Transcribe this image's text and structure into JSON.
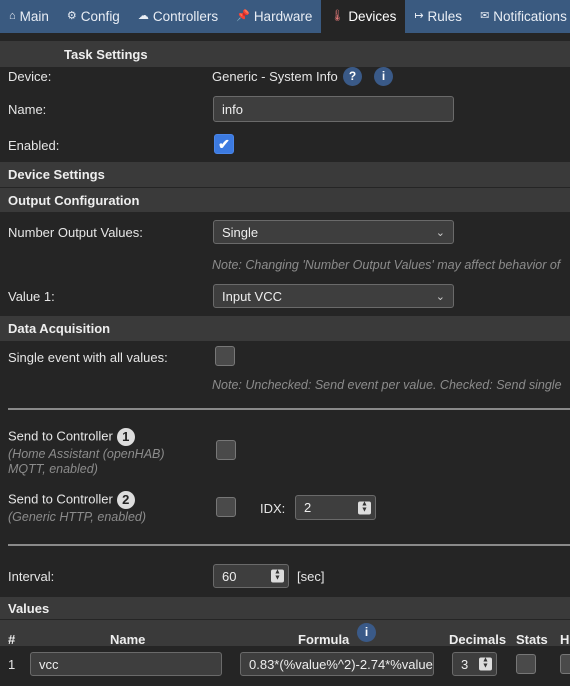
{
  "nav": {
    "tabs": [
      {
        "label": "Main",
        "icon": "home-icon",
        "glyph": "⌂"
      },
      {
        "label": "Config",
        "icon": "gear-icon",
        "glyph": "⚙"
      },
      {
        "label": "Controllers",
        "icon": "cloud-icon",
        "glyph": "☁"
      },
      {
        "label": "Hardware",
        "icon": "pin-icon",
        "glyph": "📌"
      },
      {
        "label": "Devices",
        "icon": "plug-icon",
        "glyph": "🌡"
      },
      {
        "label": "Rules",
        "icon": "rules-icon",
        "glyph": "↦"
      },
      {
        "label": "Notifications",
        "icon": "mail-icon",
        "glyph": "✉"
      }
    ],
    "active": "Devices"
  },
  "task_settings": {
    "header": "Task Settings",
    "device_label": "Device:",
    "device_value": "Generic - System Info",
    "help_glyph": "?",
    "info_glyph": "i",
    "name_label": "Name:",
    "name_value": "info",
    "enabled_label": "Enabled:",
    "enabled": true
  },
  "device_settings": {
    "header": "Device Settings",
    "output_header": "Output Configuration",
    "num_output_label": "Number Output Values:",
    "num_output_value": "Single",
    "num_output_note": "Note: Changing 'Number Output Values' may affect behavior of",
    "value1_label": "Value 1:",
    "value1_value": "Input VCC"
  },
  "data_acquisition": {
    "header": "Data Acquisition",
    "single_event_label": "Single event with all values:",
    "single_event_checked": false,
    "single_event_note": "Note: Unchecked: Send event per value. Checked: Send single",
    "controller1_label": "Send to Controller",
    "controller1_num": "1",
    "controller1_sub": "(Home Assistant (openHAB) MQTT, enabled)",
    "controller2_label": "Send to Controller",
    "controller2_num": "2",
    "controller2_sub": "(Generic HTTP, enabled)",
    "idx_label": "IDX:",
    "idx_value": "2",
    "interval_label": "Interval:",
    "interval_value": "60",
    "interval_unit": "[sec]"
  },
  "values": {
    "header": "Values",
    "columns": {
      "num": "#",
      "name": "Name",
      "formula": "Formula",
      "decimals": "Decimals",
      "stats": "Stats",
      "hidden": "Hi"
    },
    "rows": [
      {
        "num": "1",
        "name": "vcc",
        "formula": "0.83*(%value%^2)-2.74*%value",
        "decimals": "3"
      }
    ]
  }
}
